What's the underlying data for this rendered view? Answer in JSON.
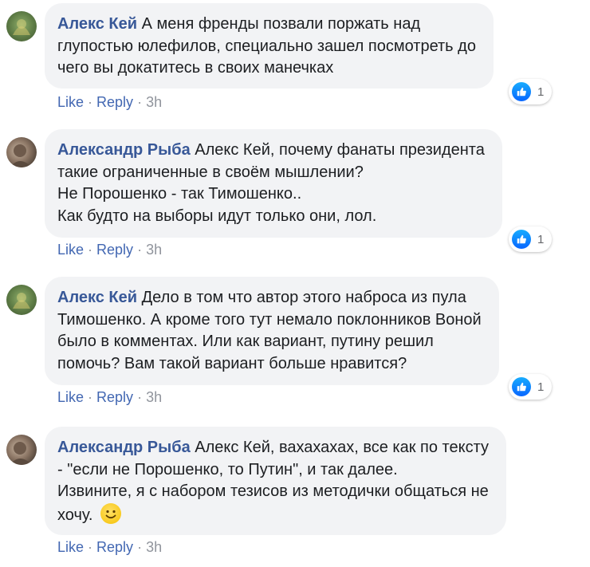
{
  "comments": [
    {
      "author": "Алекс Кей",
      "lines": [
        "А меня френды позвали поржать над",
        "глупостью юлефилов, специально зашел посмотреть до",
        "чего вы докатитесь в своих манечках"
      ],
      "reaction_count": "1",
      "actions": {
        "like": "Like",
        "reply": "Reply",
        "time": "3h"
      }
    },
    {
      "author": "Александр Рыба",
      "lines": [
        "Алекс Кей, почему фанаты президента",
        "такие ограниченные в своём мышлении?",
        "Не Порошенко - так Тимошенко..",
        "Как будто на выборы идут только они, лол."
      ],
      "reaction_count": "1",
      "actions": {
        "like": "Like",
        "reply": "Reply",
        "time": "3h"
      }
    },
    {
      "author": "Алекс Кей",
      "lines": [
        "Дело в том что автор этого наброса из пула",
        "Тимошенко. А кроме того тут немало поклонников Воной",
        "было в комментах. Или как вариант, путину решил",
        "помочь? Вам такой вариант больше нравится?"
      ],
      "reaction_count": "1",
      "actions": {
        "like": "Like",
        "reply": "Reply",
        "time": "3h"
      }
    },
    {
      "author": "Александр Рыба",
      "lines": [
        "Алекс Кей, вахахахах, все как по тексту",
        "- \"если не Порошенко, то Путин\", и так далее.",
        "Извините, я с набором тезисов из методички общаться не",
        "хочу."
      ],
      "actions": {
        "like": "Like",
        "reply": "Reply",
        "time": "3h"
      }
    }
  ],
  "colors": {
    "author": "#385898",
    "bubble": "#f2f3f5",
    "like_blue": "#0866ff",
    "meta_gray": "#90949c"
  },
  "icons": {
    "like": "thumbs-up-icon",
    "emoji": "smiling-face-icon"
  }
}
